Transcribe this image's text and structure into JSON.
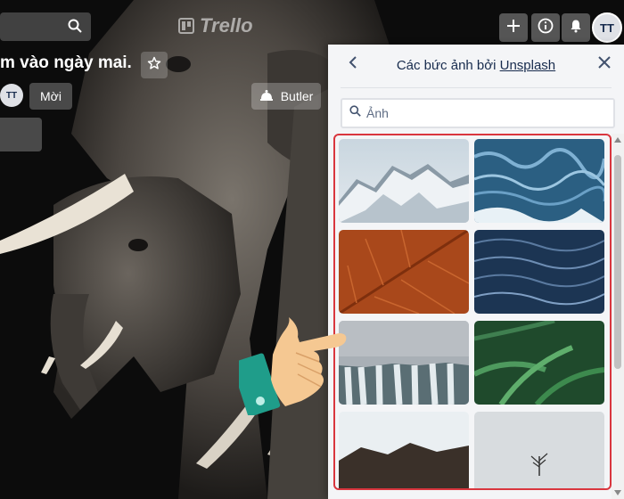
{
  "header": {
    "logo_text": "Trello",
    "avatar_initials": "TT"
  },
  "board": {
    "title": "m vào ngày mai.",
    "member_initials": "TT",
    "invite_label": "Mời",
    "butler_label": "Butler"
  },
  "panel": {
    "title_prefix": "Các bức ảnh bởi ",
    "title_link": "Unsplash",
    "search_placeholder": "Ảnh"
  },
  "icons": {
    "search": "search-icon",
    "add": "plus-icon",
    "info": "info-icon",
    "notifications": "bell-icon",
    "star": "star-icon",
    "butler": "butler-bell-icon",
    "back": "chevron-left-icon",
    "close": "close-icon"
  },
  "colors": {
    "panel_bg": "#f4f5f7",
    "highlight_border": "#d9363e",
    "text": "#172b4d"
  }
}
